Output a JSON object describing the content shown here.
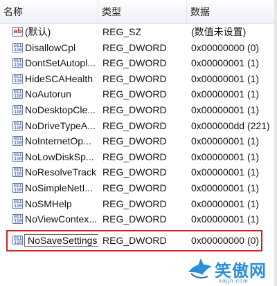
{
  "columns": {
    "name": "名称",
    "type": "类型",
    "data": "数据"
  },
  "rows": [
    {
      "icon": "string-value-icon",
      "name": "(默认)",
      "type": "REG_SZ",
      "data": "(数值未设置)"
    },
    {
      "icon": "dword-value-icon",
      "name": "DisallowCpl",
      "type": "REG_DWORD",
      "data": "0x00000000 (0)"
    },
    {
      "icon": "dword-value-icon",
      "name": "DontSetAutopl...",
      "type": "REG_DWORD",
      "data": "0x00000001 (1)"
    },
    {
      "icon": "dword-value-icon",
      "name": "HideSCAHealth",
      "type": "REG_DWORD",
      "data": "0x00000001 (1)"
    },
    {
      "icon": "dword-value-icon",
      "name": "NoAutorun",
      "type": "REG_DWORD",
      "data": "0x00000001 (1)"
    },
    {
      "icon": "dword-value-icon",
      "name": "NoDesktopCle...",
      "type": "REG_DWORD",
      "data": "0x00000001 (1)"
    },
    {
      "icon": "dword-value-icon",
      "name": "NoDriveTypeA...",
      "type": "REG_DWORD",
      "data": "0x000000dd (221)"
    },
    {
      "icon": "dword-value-icon",
      "name": "NoInternetOp...",
      "type": "REG_DWORD",
      "data": "0x00000001 (1)"
    },
    {
      "icon": "dword-value-icon",
      "name": "NoLowDiskSp...",
      "type": "REG_DWORD",
      "data": "0x00000001 (1)"
    },
    {
      "icon": "dword-value-icon",
      "name": "NoResolveTrack",
      "type": "REG_DWORD",
      "data": "0x00000001 (1)"
    },
    {
      "icon": "dword-value-icon",
      "name": "NoSimpleNetI...",
      "type": "REG_DWORD",
      "data": "0x00000001 (1)"
    },
    {
      "icon": "dword-value-icon",
      "name": "NoSMHelp",
      "type": "REG_DWORD",
      "data": "0x00000001 (1)"
    },
    {
      "icon": "dword-value-icon",
      "name": "NoViewContex...",
      "type": "REG_DWORD",
      "data": "0x00000001 (1)"
    }
  ],
  "selected_row": {
    "icon": "dword-value-icon",
    "name": "NoSaveSettings",
    "type": "REG_DWORD",
    "data": "0x00000000 (0)"
  },
  "icon_glyphs": {
    "string": "ab",
    "dword": "011 110"
  },
  "watermark": {
    "text": "笑傲网",
    "url": "xajjn.com"
  },
  "colors": {
    "highlight_border": "#d32222",
    "header_bg": "#eef1f6",
    "watermark": "#2a8fd8"
  }
}
